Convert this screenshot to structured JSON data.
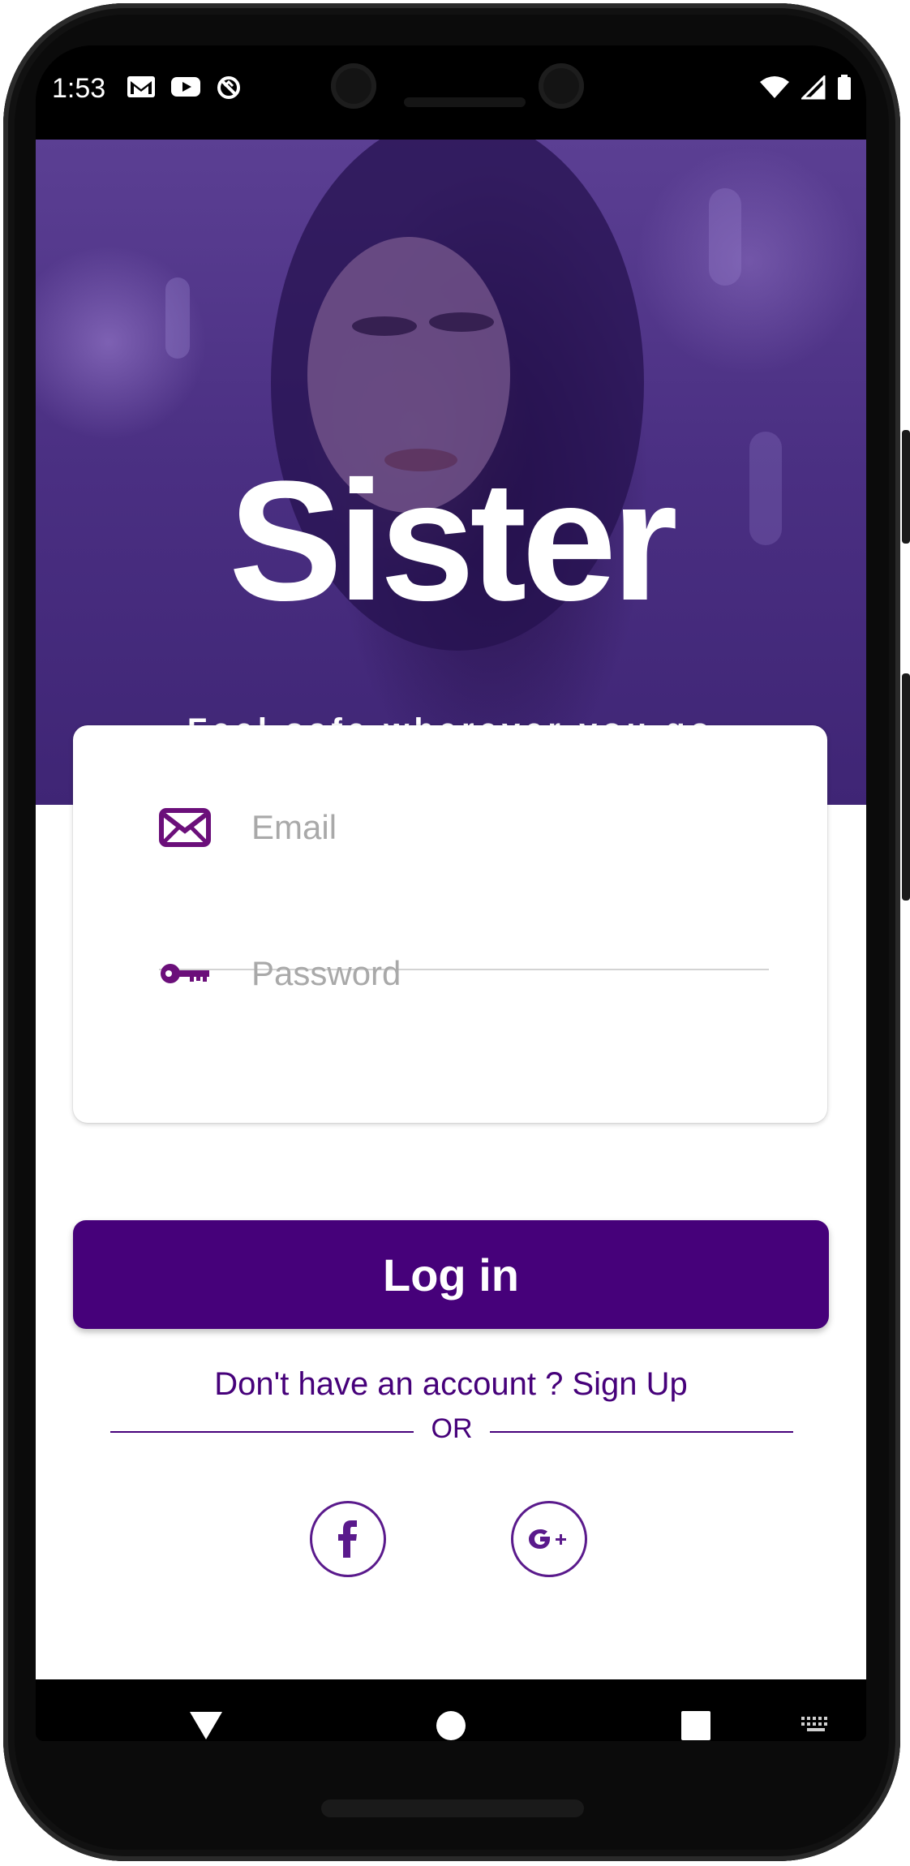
{
  "status_bar": {
    "time": "1:53",
    "left_icons": [
      "gmail-icon",
      "youtube-icon",
      "sync-off-icon"
    ],
    "right_icons": [
      "wifi-icon",
      "signal-icon",
      "battery-icon"
    ]
  },
  "hero": {
    "logo_text": "Sister",
    "tagline": "Feel safe wherever you go"
  },
  "login_form": {
    "email_placeholder": "Email",
    "password_placeholder": "Password"
  },
  "actions": {
    "login_label": "Log in",
    "signup_prompt": "Don't have an account ? Sign Up",
    "or_label": "OR"
  },
  "social": [
    "facebook",
    "google-plus"
  ],
  "colors": {
    "brand_purple": "#46017a",
    "hero_overlay": "#4a2f82"
  },
  "nav_bar": [
    "back-icon",
    "home-icon",
    "recents-icon",
    "keyboard-icon"
  ]
}
